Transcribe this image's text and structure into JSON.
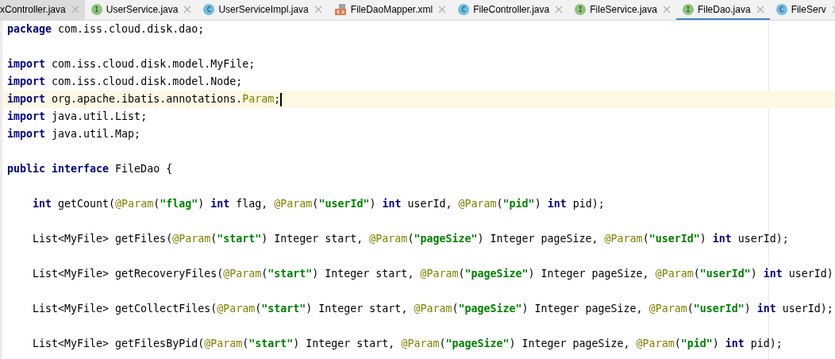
{
  "tabs": [
    {
      "name": "xController.java",
      "kind": "plain",
      "highlighted": true,
      "selected": false
    },
    {
      "name": "UserService.java",
      "kind": "interface",
      "badge": "I",
      "highlighted": false,
      "selected": false
    },
    {
      "name": "UserServiceImpl.java",
      "kind": "class",
      "badge": "C",
      "highlighted": false,
      "selected": false
    },
    {
      "name": "FileDaoMapper.xml",
      "kind": "xml",
      "highlighted": false,
      "selected": false
    },
    {
      "name": "FileController.java",
      "kind": "class",
      "badge": "C",
      "highlighted": false,
      "selected": false
    },
    {
      "name": "FileService.java",
      "kind": "interface",
      "badge": "I",
      "highlighted": false,
      "selected": false
    },
    {
      "name": "FileDao.java",
      "kind": "interface",
      "badge": "I",
      "highlighted": false,
      "selected": true
    },
    {
      "name": "FileServ",
      "kind": "class",
      "badge": "C",
      "highlighted": false,
      "selected": false
    }
  ],
  "editor": {
    "lines": [
      {
        "kind": "code",
        "current": false,
        "tokens": [
          {
            "text": "package",
            "kind": "keyword"
          },
          {
            "text": " com.iss.cloud.disk.dao;",
            "kind": "plain"
          }
        ]
      },
      {
        "kind": "blank"
      },
      {
        "kind": "code",
        "current": false,
        "tokens": [
          {
            "text": "import",
            "kind": "keyword"
          },
          {
            "text": " com.iss.cloud.disk.model.MyFile;",
            "kind": "plain"
          }
        ]
      },
      {
        "kind": "code",
        "current": false,
        "tokens": [
          {
            "text": "import",
            "kind": "keyword"
          },
          {
            "text": " com.iss.cloud.disk.model.Node;",
            "kind": "plain"
          }
        ]
      },
      {
        "kind": "code",
        "current": true,
        "tokens": [
          {
            "text": "import",
            "kind": "keyword"
          },
          {
            "text": " org.apache.ibatis.annotations.",
            "kind": "plain"
          },
          {
            "text": "Param",
            "kind": "annotation"
          },
          {
            "text": ";",
            "kind": "plain"
          }
        ]
      },
      {
        "kind": "code",
        "current": false,
        "tokens": [
          {
            "text": "import",
            "kind": "keyword"
          },
          {
            "text": " java.util.List;",
            "kind": "plain"
          }
        ]
      },
      {
        "kind": "code",
        "current": false,
        "tokens": [
          {
            "text": "import",
            "kind": "keyword"
          },
          {
            "text": " java.util.Map;",
            "kind": "plain"
          }
        ]
      },
      {
        "kind": "blank"
      },
      {
        "kind": "code",
        "current": false,
        "tokens": [
          {
            "text": "public interface",
            "kind": "keyword"
          },
          {
            "text": " FileDao {",
            "kind": "plain"
          }
        ]
      },
      {
        "kind": "blank"
      },
      {
        "kind": "member",
        "current": false,
        "tokens": [
          {
            "text": "int",
            "kind": "keyword"
          },
          {
            "text": " getCount(",
            "kind": "plain"
          },
          {
            "text": "@Param",
            "kind": "annotation"
          },
          {
            "text": "(",
            "kind": "plain"
          },
          {
            "text": "\"flag\"",
            "kind": "string"
          },
          {
            "text": ") ",
            "kind": "plain"
          },
          {
            "text": "int",
            "kind": "keyword"
          },
          {
            "text": " flag, ",
            "kind": "plain"
          },
          {
            "text": "@Param",
            "kind": "annotation"
          },
          {
            "text": "(",
            "kind": "plain"
          },
          {
            "text": "\"userId\"",
            "kind": "string"
          },
          {
            "text": ") ",
            "kind": "plain"
          },
          {
            "text": "int",
            "kind": "keyword"
          },
          {
            "text": " userId, ",
            "kind": "plain"
          },
          {
            "text": "@Param",
            "kind": "annotation"
          },
          {
            "text": "(",
            "kind": "plain"
          },
          {
            "text": "\"pid\"",
            "kind": "string"
          },
          {
            "text": ") ",
            "kind": "plain"
          },
          {
            "text": "int",
            "kind": "keyword"
          },
          {
            "text": " pid);",
            "kind": "plain"
          }
        ]
      },
      {
        "kind": "blank"
      },
      {
        "kind": "member",
        "current": false,
        "tokens": [
          {
            "text": "List<MyFile> getFiles(",
            "kind": "plain"
          },
          {
            "text": "@Param",
            "kind": "annotation"
          },
          {
            "text": "(",
            "kind": "plain"
          },
          {
            "text": "\"start\"",
            "kind": "string"
          },
          {
            "text": ") Integer start, ",
            "kind": "plain"
          },
          {
            "text": "@Param",
            "kind": "annotation"
          },
          {
            "text": "(",
            "kind": "plain"
          },
          {
            "text": "\"pageSize\"",
            "kind": "string"
          },
          {
            "text": ") Integer pageSize, ",
            "kind": "plain"
          },
          {
            "text": "@Param",
            "kind": "annotation"
          },
          {
            "text": "(",
            "kind": "plain"
          },
          {
            "text": "\"userId\"",
            "kind": "string"
          },
          {
            "text": ") ",
            "kind": "plain"
          },
          {
            "text": "int",
            "kind": "keyword"
          },
          {
            "text": " userId);",
            "kind": "plain"
          }
        ]
      },
      {
        "kind": "blank"
      },
      {
        "kind": "member",
        "current": false,
        "tokens": [
          {
            "text": "List<MyFile> getRecoveryFiles(",
            "kind": "plain"
          },
          {
            "text": "@Param",
            "kind": "annotation"
          },
          {
            "text": "(",
            "kind": "plain"
          },
          {
            "text": "\"start\"",
            "kind": "string"
          },
          {
            "text": ") Integer start, ",
            "kind": "plain"
          },
          {
            "text": "@Param",
            "kind": "annotation"
          },
          {
            "text": "(",
            "kind": "plain"
          },
          {
            "text": "\"pageSize\"",
            "kind": "string"
          },
          {
            "text": ") Integer pageSize, ",
            "kind": "plain"
          },
          {
            "text": "@Param",
            "kind": "annotation"
          },
          {
            "text": "(",
            "kind": "plain"
          },
          {
            "text": "\"userId\"",
            "kind": "string"
          },
          {
            "text": ") ",
            "kind": "plain"
          },
          {
            "text": "int",
            "kind": "keyword"
          },
          {
            "text": " userId)",
            "kind": "plain"
          }
        ]
      },
      {
        "kind": "blank"
      },
      {
        "kind": "member",
        "current": false,
        "tokens": [
          {
            "text": "List<MyFile> getCollectFiles(",
            "kind": "plain"
          },
          {
            "text": "@Param",
            "kind": "annotation"
          },
          {
            "text": "(",
            "kind": "plain"
          },
          {
            "text": "\"start\"",
            "kind": "string"
          },
          {
            "text": ") Integer start, ",
            "kind": "plain"
          },
          {
            "text": "@Param",
            "kind": "annotation"
          },
          {
            "text": "(",
            "kind": "plain"
          },
          {
            "text": "\"pageSize\"",
            "kind": "string"
          },
          {
            "text": ") Integer pageSize, ",
            "kind": "plain"
          },
          {
            "text": "@Param",
            "kind": "annotation"
          },
          {
            "text": "(",
            "kind": "plain"
          },
          {
            "text": "\"userId\"",
            "kind": "string"
          },
          {
            "text": ") ",
            "kind": "plain"
          },
          {
            "text": "int",
            "kind": "keyword"
          },
          {
            "text": " userId);",
            "kind": "plain"
          }
        ]
      },
      {
        "kind": "blank"
      },
      {
        "kind": "member",
        "current": false,
        "tokens": [
          {
            "text": "List<MyFile> getFilesByPid(",
            "kind": "plain"
          },
          {
            "text": "@Param",
            "kind": "annotation"
          },
          {
            "text": "(",
            "kind": "plain"
          },
          {
            "text": "\"start\"",
            "kind": "string"
          },
          {
            "text": ") Integer start, ",
            "kind": "plain"
          },
          {
            "text": "@Param",
            "kind": "annotation"
          },
          {
            "text": "(",
            "kind": "plain"
          },
          {
            "text": "\"pageSize\"",
            "kind": "string"
          },
          {
            "text": ") Integer pageSize, ",
            "kind": "plain"
          },
          {
            "text": "@Param",
            "kind": "annotation"
          },
          {
            "text": "(",
            "kind": "plain"
          },
          {
            "text": "\"pid\"",
            "kind": "string"
          },
          {
            "text": ") ",
            "kind": "plain"
          },
          {
            "text": "int",
            "kind": "keyword"
          },
          {
            "text": " pid);",
            "kind": "plain"
          }
        ]
      }
    ]
  }
}
